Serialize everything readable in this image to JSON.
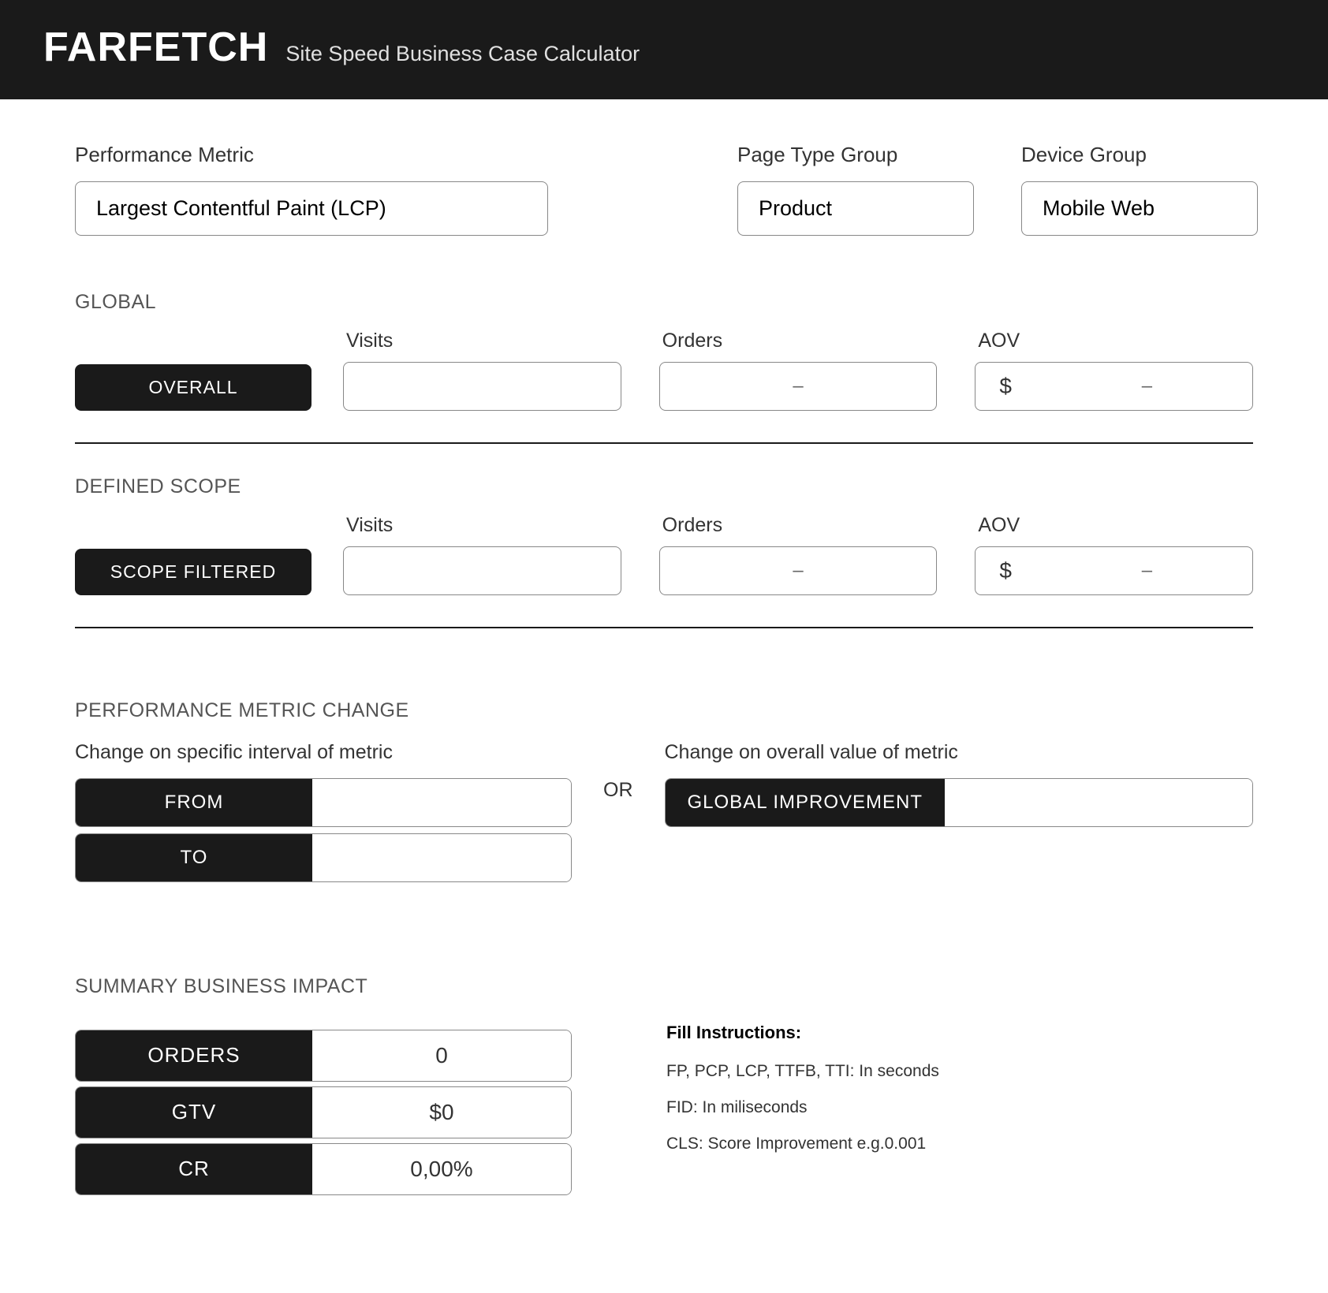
{
  "header": {
    "logo": "FARFETCH",
    "subtitle": "Site Speed Business Case Calculator"
  },
  "filters": {
    "metric": {
      "label": "Performance Metric",
      "value": "Largest Contentful Paint (LCP)"
    },
    "pageType": {
      "label": "Page Type Group",
      "value": "Product"
    },
    "device": {
      "label": "Device Group",
      "value": "Mobile Web"
    }
  },
  "global": {
    "section": "GLOBAL",
    "badge": "OVERALL",
    "visitsLabel": "Visits",
    "ordersLabel": "Orders",
    "aovLabel": "AOV",
    "visits": "",
    "orders": "–",
    "aovCurrency": "$",
    "aov": "–"
  },
  "scope": {
    "section": "DEFINED SCOPE",
    "badge": "SCOPE FILTERED",
    "visitsLabel": "Visits",
    "ordersLabel": "Orders",
    "aovLabel": "AOV",
    "visits": "",
    "orders": "–",
    "aovCurrency": "$",
    "aov": "–"
  },
  "change": {
    "section": "PERFORMANCE METRIC CHANGE",
    "intervalLabel": "Change on specific interval of metric",
    "fromLabel": "FROM",
    "toLabel": "TO",
    "fromValue": "",
    "toValue": "",
    "orText": "OR",
    "overallLabel": "Change on overall value of metric",
    "globalImpLabel": "GLOBAL IMPROVEMENT",
    "globalImpValue": ""
  },
  "summary": {
    "section": "SUMMARY BUSINESS IMPACT",
    "rows": [
      {
        "label": "ORDERS",
        "value": "0"
      },
      {
        "label": "GTV",
        "value": "$0"
      },
      {
        "label": "CR",
        "value": "0,00%"
      }
    ]
  },
  "instructions": {
    "title": "Fill Instructions:",
    "lines": [
      "FP, PCP, LCP, TTFB, TTI: In seconds",
      "FID: In miliseconds",
      "CLS: Score Improvement e.g.0.001"
    ]
  }
}
